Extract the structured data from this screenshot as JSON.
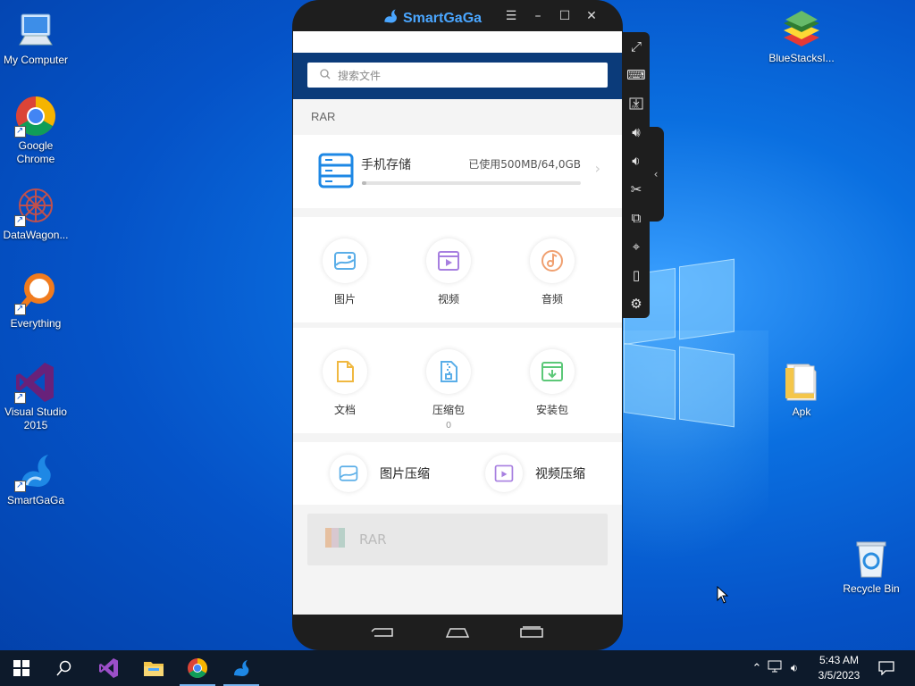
{
  "desktop": {
    "icons_left": [
      {
        "label": "My Computer",
        "icon": "computer-icon"
      },
      {
        "label": "Google Chrome",
        "icon": "chrome-icon"
      },
      {
        "label": "DataWagon...",
        "icon": "datawagon-icon"
      },
      {
        "label": "Everything",
        "icon": "everything-search-icon"
      },
      {
        "label": "Visual Studio 2015",
        "icon": "visual-studio-icon"
      },
      {
        "label": "SmartGaGa",
        "icon": "smartgaga-icon"
      }
    ],
    "icons_right": [
      {
        "label": "BlueStacksI...",
        "icon": "bluestacks-icon"
      },
      {
        "label": "Apk",
        "icon": "folder-icon"
      },
      {
        "label": "Recycle Bin",
        "icon": "recycle-bin-icon"
      }
    ]
  },
  "emulator": {
    "title": "SmartGaGa",
    "controls": [
      "menu-icon",
      "minimize-icon",
      "maximize-icon",
      "close-icon"
    ],
    "side_toolbar": [
      "fullscreen-icon",
      "keyboard-icon",
      "apk-install-icon",
      "volume-up-icon",
      "volume-down-icon",
      "screenshot-cut-icon",
      "multi-instance-icon",
      "location-icon",
      "shake-icon",
      "settings-icon"
    ]
  },
  "app": {
    "search_placeholder": "搜索文件",
    "section_label": "RAR",
    "storage": {
      "name": "手机存储",
      "used": "已使用500MB/64,0GB",
      "used_fraction": 0.01
    },
    "categories": [
      {
        "label": "图片",
        "icon": "image-icon",
        "color": "#5aaee8"
      },
      {
        "label": "视频",
        "icon": "video-icon",
        "color": "#a77fe0"
      },
      {
        "label": "音频",
        "icon": "audio-icon",
        "color": "#f0a070"
      },
      {
        "label": "文档",
        "icon": "document-icon",
        "color": "#f0b840"
      },
      {
        "label": "压缩包",
        "icon": "archive-icon",
        "color": "#5aaee8",
        "count": "0"
      },
      {
        "label": "安装包",
        "icon": "apk-package-icon",
        "color": "#5cc878"
      }
    ],
    "compress": [
      {
        "label": "图片压缩",
        "icon": "image-compress-icon"
      },
      {
        "label": "视频压缩",
        "icon": "video-compress-icon"
      }
    ],
    "rar_banner": "RAR"
  },
  "taskbar": {
    "items": [
      "start-icon",
      "search-icon",
      "visual-studio-icon",
      "file-explorer-icon",
      "chrome-icon",
      "smartgaga-icon"
    ],
    "time": "5:43 AM",
    "date": "3/5/2023"
  }
}
